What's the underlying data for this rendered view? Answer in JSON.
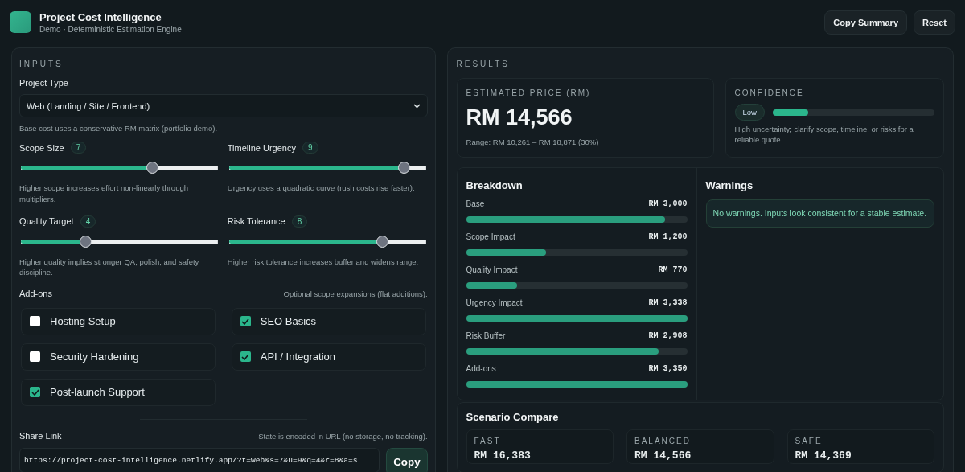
{
  "header": {
    "title": "Project Cost Intelligence",
    "subtitle": "Demo · Deterministic Estimation Engine",
    "buttons": [
      "Copy Summary",
      "Reset"
    ]
  },
  "inputs": {
    "heading": "INPUTS",
    "project_type": {
      "label": "Project Type",
      "value": "Web (Landing / Site / Frontend)",
      "help": "Base cost uses a conservative RM matrix (portfolio demo)."
    },
    "sliders": [
      {
        "label": "Scope Size",
        "value": "7",
        "level": 0.67,
        "help": "Higher scope increases effort non-linearly through multipliers."
      },
      {
        "label": "Timeline Urgency",
        "value": "9",
        "level": 0.89,
        "help": "Urgency uses a quadratic curve (rush costs rise faster)."
      },
      {
        "label": "Quality Target",
        "value": "4",
        "level": 0.33,
        "help": "Higher quality implies stronger QA, polish, and safety discipline."
      },
      {
        "label": "Risk Tolerance",
        "value": "8",
        "level": 0.78,
        "help": "Higher risk tolerance increases buffer and widens range."
      }
    ],
    "addons": {
      "label": "Add-ons",
      "note": "Optional scope expansions (flat additions).",
      "items": [
        {
          "label": "Hosting Setup",
          "checked": false
        },
        {
          "label": "SEO Basics",
          "checked": true
        },
        {
          "label": "Security Hardening",
          "checked": false
        },
        {
          "label": "API / Integration",
          "checked": true
        },
        {
          "label": "Post-launch Support",
          "checked": true
        }
      ]
    },
    "share": {
      "label": "Share Link",
      "note": "State is encoded in URL (no storage, no tracking).",
      "value": "https://project-cost-intelligence.netlify.app/?t=web&s=7&u=9&q=4&r=8&a=s",
      "button": "Copy"
    }
  },
  "results": {
    "heading": "RESULTS",
    "estimate": {
      "label": "ESTIMATED PRICE (RM)",
      "value": "RM 14,566",
      "range": "Range: RM 10,261 – RM 18,871 (30%)"
    },
    "confidence": {
      "label": "CONFIDENCE",
      "badge": "Low",
      "level": 0.22,
      "note": "High uncertainty; clarify scope, timeline, or risks for a reliable quote."
    },
    "breakdown": {
      "title": "Breakdown",
      "items": [
        {
          "label": "Base",
          "value": "RM 3,000",
          "level": 0.9
        },
        {
          "label": "Scope Impact",
          "value": "RM 1,200",
          "level": 0.36
        },
        {
          "label": "Quality Impact",
          "value": "RM 770",
          "level": 0.23
        },
        {
          "label": "Urgency Impact",
          "value": "RM 3,338",
          "level": 1
        },
        {
          "label": "Risk Buffer",
          "value": "RM 2,908",
          "level": 0.87
        },
        {
          "label": "Add-ons",
          "value": "RM 3,350",
          "level": 1
        }
      ]
    },
    "warnings": {
      "title": "Warnings",
      "message": "No warnings. Inputs look consistent for a stable estimate."
    },
    "scenarios": {
      "title": "Scenario Compare",
      "items": [
        {
          "label": "FAST",
          "value": "RM 16,383"
        },
        {
          "label": "BALANCED",
          "value": "RM 14,566"
        },
        {
          "label": "SAFE",
          "value": "RM 14,369"
        }
      ]
    }
  }
}
